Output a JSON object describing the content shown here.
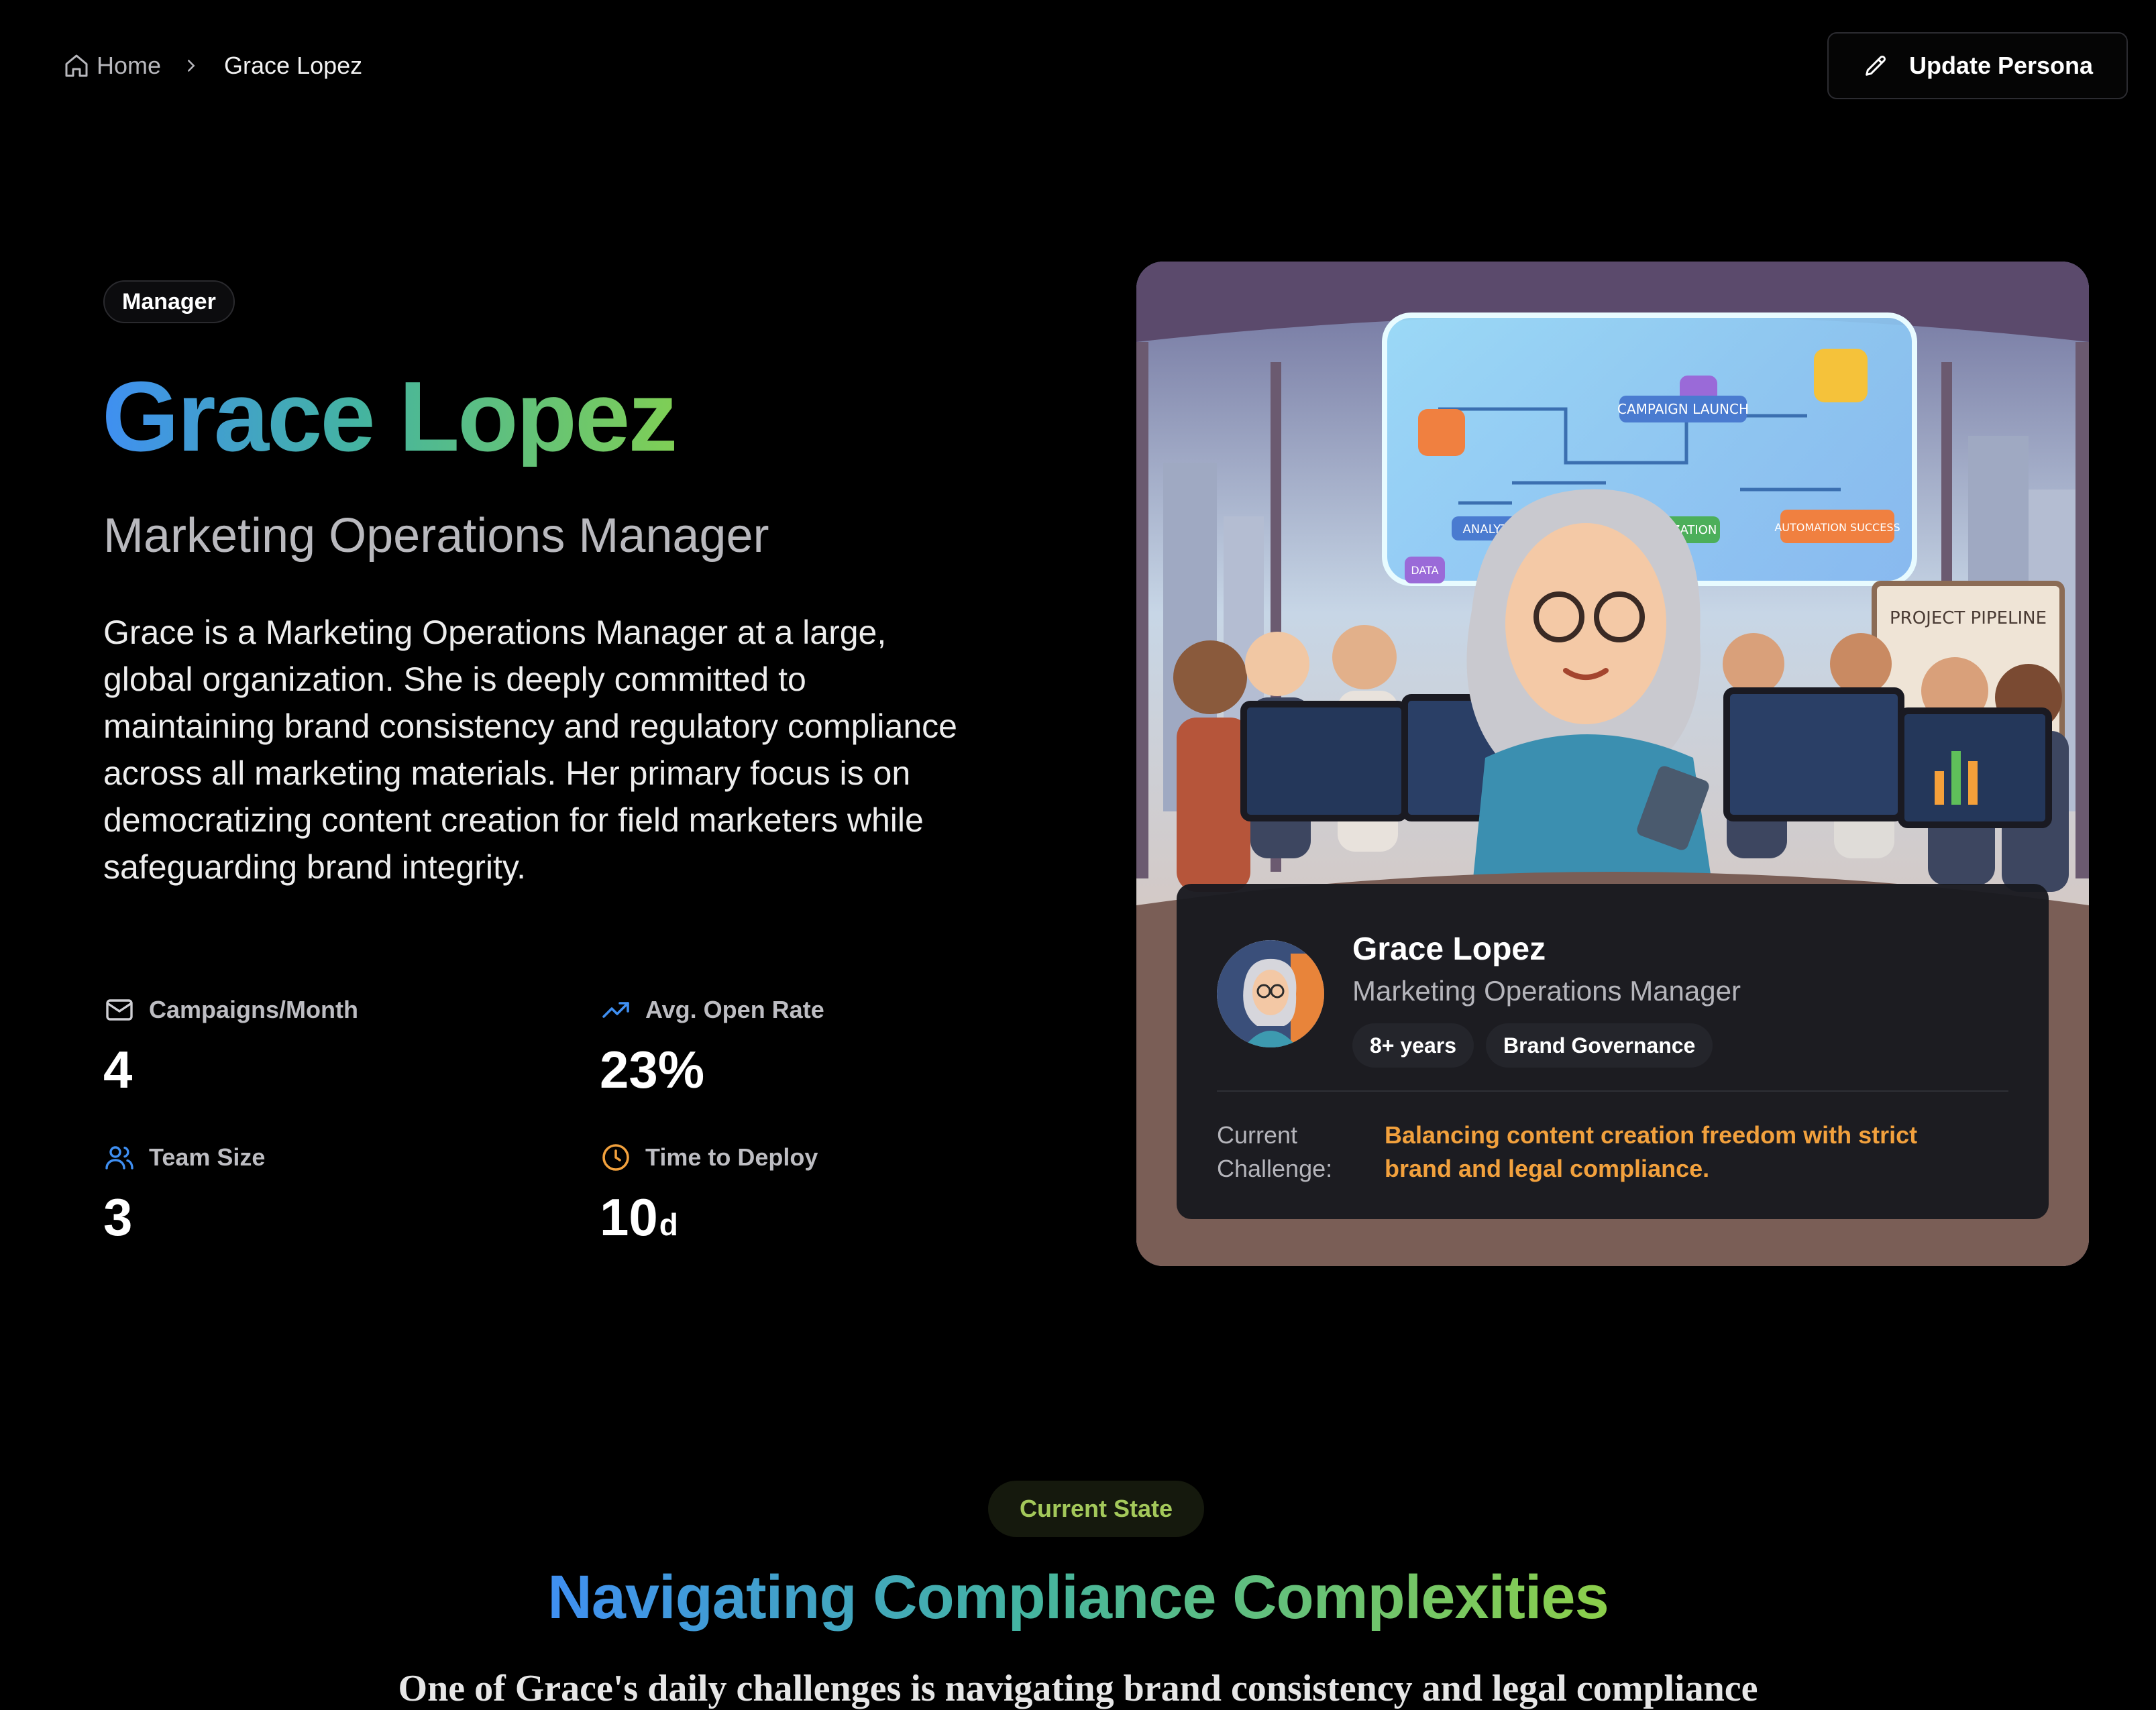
{
  "breadcrumb": {
    "home_label": "Home",
    "current_label": "Grace Lopez"
  },
  "actions": {
    "update_persona_label": "Update Persona"
  },
  "hero": {
    "role_badge": "Manager",
    "name": "Grace Lopez",
    "title": "Marketing Operations Manager",
    "description": "Grace is a Marketing Operations Manager at a large, global organization. She is deeply committed to maintaining brand consistency and regulatory compliance across all marketing materials. Her primary focus is on democratizing content creation for field marketers while safeguarding brand integrity."
  },
  "stats": [
    {
      "label": "Campaigns/Month",
      "value": "4",
      "unit": "",
      "icon": "mail-icon",
      "color": "#cfcfd4"
    },
    {
      "label": "Avg. Open Rate",
      "value": "23%",
      "unit": "",
      "icon": "trending-up-icon",
      "color": "#3f8ff2"
    },
    {
      "label": "Team Size",
      "value": "3",
      "unit": "",
      "icon": "users-icon",
      "color": "#3f8ff2"
    },
    {
      "label": "Time to Deploy",
      "value": "10",
      "unit": "d",
      "icon": "clock-icon",
      "color": "#f2a13d"
    }
  ],
  "illustration": {
    "labels": [
      "CAMPAIGN LAUNCH",
      "ANALYTICS",
      "Q3 OPTIMIZATION",
      "AUTOMATION SUCCESS",
      "DATA",
      "PROJECT PIPELINE"
    ]
  },
  "persona_card": {
    "name": "Grace Lopez",
    "title": "Marketing Operations Manager",
    "tags": [
      "8+ years",
      "Brand Governance"
    ],
    "challenge_label": "Current Challenge:",
    "challenge_text": "Balancing content creation freedom with strict brand and legal compliance."
  },
  "section": {
    "badge": "Current State",
    "title": "Navigating Compliance Complexities",
    "subtitle": "One of Grace's daily challenges is navigating brand consistency and legal compliance"
  },
  "colors": {
    "accent_blue": "#3f8ff2",
    "accent_teal": "#44b4a0",
    "accent_green": "#7fcf55",
    "accent_orange": "#f2a13d"
  }
}
